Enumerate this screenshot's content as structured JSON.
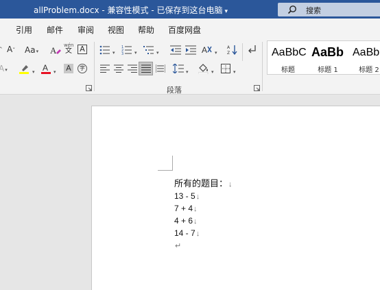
{
  "titlebar": {
    "filename": "allProblem.docx",
    "separator1": " - ",
    "mode": "兼容性模式",
    "separator2": " - ",
    "save_status": "已保存到这台电脑",
    "search_placeholder": "搜索"
  },
  "tabs": [
    "引用",
    "邮件",
    "审阅",
    "视图",
    "帮助",
    "百度网盘"
  ],
  "ribbon": {
    "font_size_label": "A",
    "change_case_label": "Aa",
    "phonetic_top": "wén",
    "phonetic_bottom": "文",
    "char_border_label": "A",
    "char_shading_label": "A",
    "enclose_char_label": "字",
    "paragraph_group_label": "段落",
    "styles": [
      {
        "sample": "AaBbC",
        "name": "标题"
      },
      {
        "sample": "AaBb",
        "name": "标题 1"
      },
      {
        "sample": "AaBb",
        "name": "标题 2"
      }
    ]
  },
  "colors": {
    "titlebar_bg": "#2b579a",
    "highlight": "#ffff00",
    "font_color": "#e81123"
  },
  "document": {
    "heading": "所有的题目：",
    "lines": [
      "13 - 5",
      "7 + 4",
      "4 + 6",
      "14 - 7"
    ],
    "line_break_mark": "↓",
    "paragraph_mark": "↵"
  }
}
